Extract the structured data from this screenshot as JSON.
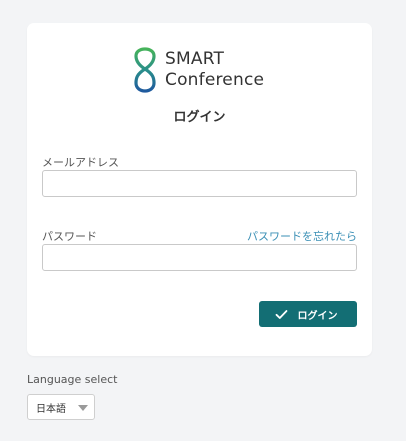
{
  "logo": {
    "icon": "infinity-8-logo-icon",
    "line1": "SMART",
    "line2": "Conference",
    "colors": {
      "green": "#3aa35c",
      "blue": "#1f5a9e"
    }
  },
  "form": {
    "title": "ログイン",
    "email_label": "メールアドレス",
    "email_value": "",
    "password_label": "パスワード",
    "password_value": "",
    "forgot_link": "パスワードを忘れたら",
    "login_button": "ログイン",
    "login_icon": "check-icon"
  },
  "language": {
    "label": "Language select",
    "selected": "日本語",
    "caret_icon": "caret-down-icon"
  },
  "colors": {
    "page_background": "#f3f4f6",
    "primary": "#136e74",
    "link": "#3a8fb5"
  }
}
